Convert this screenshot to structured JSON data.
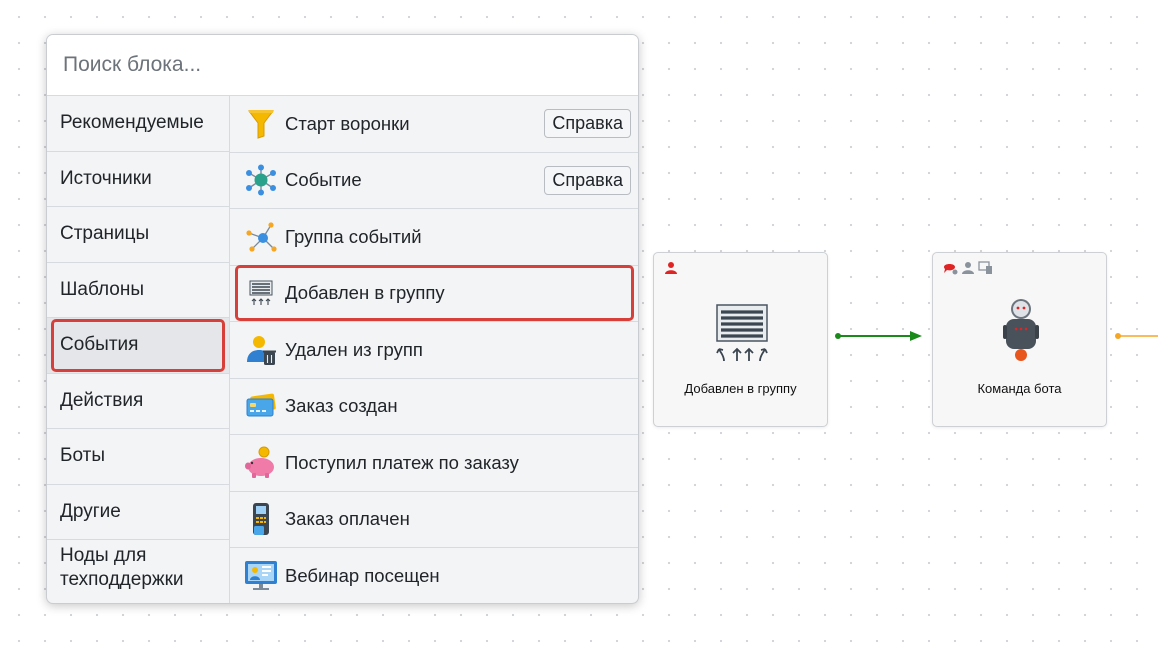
{
  "search": {
    "placeholder": "Поиск блока..."
  },
  "categories": [
    {
      "label": "Рекомендуемые"
    },
    {
      "label": "Источники"
    },
    {
      "label": "Страницы"
    },
    {
      "label": "Шаблоны"
    },
    {
      "label": "События",
      "active": true
    },
    {
      "label": "Действия"
    },
    {
      "label": "Боты"
    },
    {
      "label": "Другие"
    },
    {
      "label": "Ноды для техподдержки"
    }
  ],
  "items": [
    {
      "label": "Старт воронки",
      "icon": "funnel-icon",
      "help": "Справка"
    },
    {
      "label": "Событие",
      "icon": "event-network-icon",
      "help": "Справка"
    },
    {
      "label": "Группа событий",
      "icon": "event-group-icon"
    },
    {
      "label": "Добавлен в группу",
      "icon": "added-to-group-icon",
      "highlighted": true
    },
    {
      "label": "Удален из групп",
      "icon": "user-removed-icon"
    },
    {
      "label": "Заказ создан",
      "icon": "card-icon"
    },
    {
      "label": "Поступил платеж по заказу",
      "icon": "piggy-bank-icon"
    },
    {
      "label": "Заказ оплачен",
      "icon": "payment-terminal-icon"
    },
    {
      "label": "Вебинар посещен",
      "icon": "webinar-icon"
    }
  ],
  "nodes": [
    {
      "title": "Добавлен в группу",
      "icon": "added-to-group-icon",
      "badges": [
        "user-icon"
      ]
    },
    {
      "title": "Команда бота",
      "icon": "robot-icon",
      "badges": [
        "chat-icon",
        "user-icon",
        "device-icon"
      ]
    }
  ],
  "colors": {
    "highlight": "#d7403a",
    "edge": "#1a8a1a",
    "edge_out": "#f5a623"
  }
}
